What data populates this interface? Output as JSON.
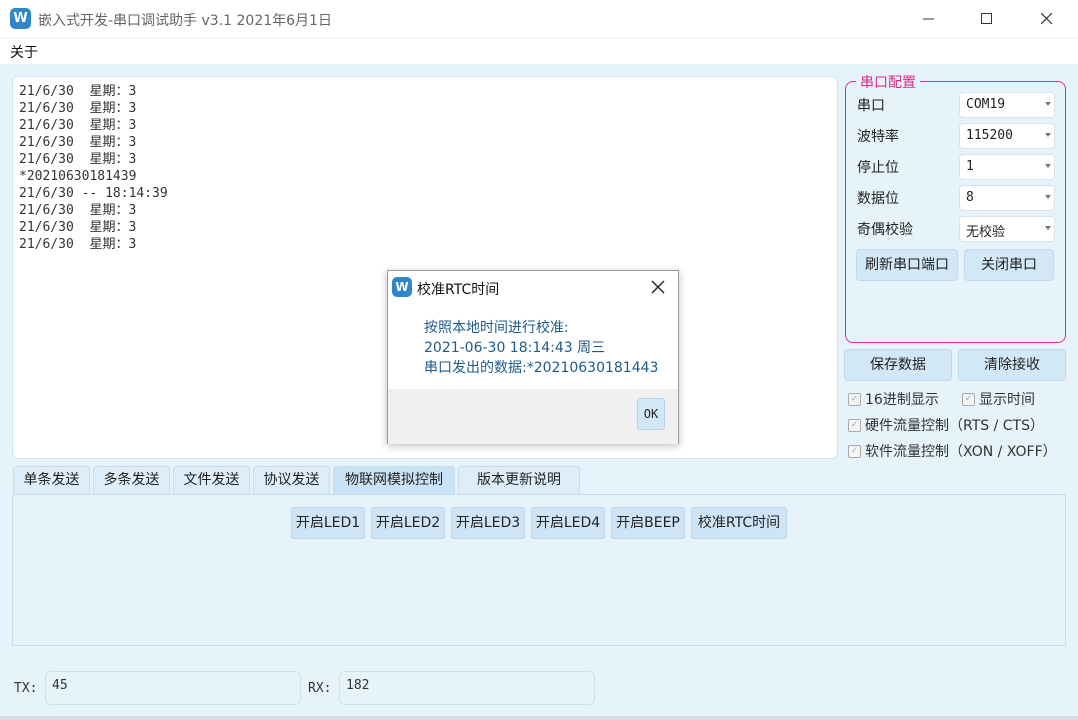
{
  "window": {
    "icon_letter": "W",
    "title": "嵌入式开发-串口调试助手 v3.1 2021年6月1日"
  },
  "menu": {
    "about": "关于"
  },
  "receive": {
    "lines": [
      "21/6/30  星期：3",
      "21/6/30  星期：3",
      "21/6/30  星期：3",
      "21/6/30  星期：3",
      "21/6/30  星期：3",
      "*20210630181439",
      "21/6/30 -- 18:14:39",
      "21/6/30  星期：3",
      "21/6/30  星期：3",
      "21/6/30  星期：3"
    ]
  },
  "serial_config": {
    "title": "串口配置",
    "port_label": "串口",
    "port_value": "COM19",
    "baud_label": "波特率",
    "baud_value": "115200",
    "stop_label": "停止位",
    "stop_value": "1",
    "data_label": "数据位",
    "data_value": "8",
    "parity_label": "奇偶校验",
    "parity_value": "无校验",
    "refresh_button": "刷新串口端口",
    "close_button": "关闭串口"
  },
  "actions": {
    "save_button": "保存数据",
    "clear_button": "清除接收"
  },
  "options": {
    "hex_display": "16进制显示",
    "show_time": "显示时间",
    "hw_flow": "硬件流量控制（RTS / CTS）",
    "sw_flow": "软件流量控制（XON / XOFF）"
  },
  "tabs": [
    "单条发送",
    "多条发送",
    "文件发送",
    "协议发送",
    "物联网模拟控制",
    "版本更新说明"
  ],
  "iot_buttons": [
    "开启LED1",
    "开启LED2",
    "开启LED3",
    "开启LED4",
    "开启BEEP",
    "校准RTC时间"
  ],
  "stats": {
    "tx_label": "TX:",
    "tx_value": "45",
    "rx_label": "RX:",
    "rx_value": "182"
  },
  "dialog": {
    "title": "校准RTC时间",
    "line1": "按照本地时间进行校准:",
    "line2": "2021-06-30 18:14:43 周三",
    "line3": "串口发出的数据:*20210630181443",
    "ok": "OK"
  },
  "colors": {
    "accent": "#2f86c8",
    "group_border": "#e02a8a",
    "background": "#e7f3fb",
    "button": "#d3e8f7"
  }
}
